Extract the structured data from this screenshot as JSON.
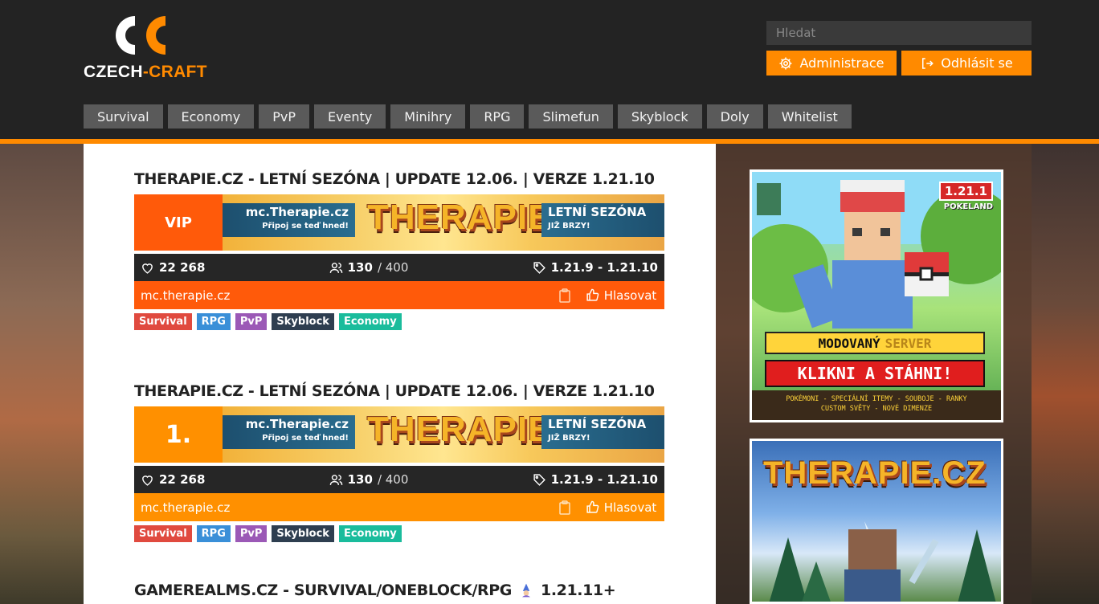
{
  "logo": {
    "part1": "CZECH",
    "separator": "-",
    "part2": "CRAFT"
  },
  "search": {
    "placeholder": "Hledat"
  },
  "header_buttons": {
    "admin": "Administrace",
    "logout": "Odhlásit se"
  },
  "nav": {
    "tabs": [
      {
        "label": "Survival"
      },
      {
        "label": "Economy"
      },
      {
        "label": "PvP"
      },
      {
        "label": "Eventy"
      },
      {
        "label": "Minihry"
      },
      {
        "label": "RPG"
      },
      {
        "label": "Slimefun"
      },
      {
        "label": "Skyblock"
      },
      {
        "label": "Doly"
      },
      {
        "label": "Whitelist"
      }
    ]
  },
  "servers": [
    {
      "title": "THERAPIE.CZ - LETNÍ SEZÓNA | UPDATE 12.06. | VERZE 1.21.10",
      "rank": "VIP",
      "rank_color": "#ff5a0a",
      "banner": {
        "address": "mc.Therapie.cz",
        "subtitle": "Připoj se teď hned!",
        "logo": "THERAPIE",
        "right_title": "LETNÍ SEZÓNA",
        "right_sub": "JIŽ BRZY!"
      },
      "likes": "22 268",
      "players_online": "130",
      "players_max": "/ 400",
      "version": "1.21.9 - 1.21.10",
      "address": "mc.therapie.cz",
      "vote_label": "Hlasovat",
      "accent": "#ff5a0a",
      "tags": [
        {
          "label": "Survival",
          "color": "#e04a3f"
        },
        {
          "label": "RPG",
          "color": "#3a8fd8"
        },
        {
          "label": "PvP",
          "color": "#9b59b6"
        },
        {
          "label": "Skyblock",
          "color": "#2e3e50"
        },
        {
          "label": "Economy",
          "color": "#1abc9c"
        }
      ]
    },
    {
      "title": "THERAPIE.CZ - LETNÍ SEZÓNA | UPDATE 12.06. | VERZE 1.21.10",
      "rank": "1.",
      "rank_color": "#ff9000",
      "banner": {
        "address": "mc.Therapie.cz",
        "subtitle": "Připoj se teď hned!",
        "logo": "THERAPIE",
        "right_title": "LETNÍ SEZÓNA",
        "right_sub": "JIŽ BRZY!"
      },
      "likes": "22 268",
      "players_online": "130",
      "players_max": "/ 400",
      "version": "1.21.9 - 1.21.10",
      "address": "mc.therapie.cz",
      "vote_label": "Hlasovat",
      "accent": "#ff9000",
      "tags": [
        {
          "label": "Survival",
          "color": "#e04a3f"
        },
        {
          "label": "RPG",
          "color": "#3a8fd8"
        },
        {
          "label": "PvP",
          "color": "#9b59b6"
        },
        {
          "label": "Skyblock",
          "color": "#2e3e50"
        },
        {
          "label": "Economy",
          "color": "#1abc9c"
        }
      ]
    },
    {
      "title": "GAMEREALMS.CZ - SURVIVAL/ONEBLOCK/RPG",
      "title_suffix": "1.21.11+"
    }
  ],
  "ads": [
    {
      "version_badge": "1.21.1",
      "brand": "POKELAND",
      "line1_a": "MODOVANÝ",
      "line1_b": "SERVER",
      "line2": "KLIKNI A STÁHNI!",
      "line3": "POKÉMONI - SPECIÁLNÍ ITEMY - SOUBOJE - RANKY",
      "line4": "CUSTOM SVĚTY - NOVÉ DIMENZE"
    },
    {
      "title": "THERAPIE.CZ"
    }
  ]
}
